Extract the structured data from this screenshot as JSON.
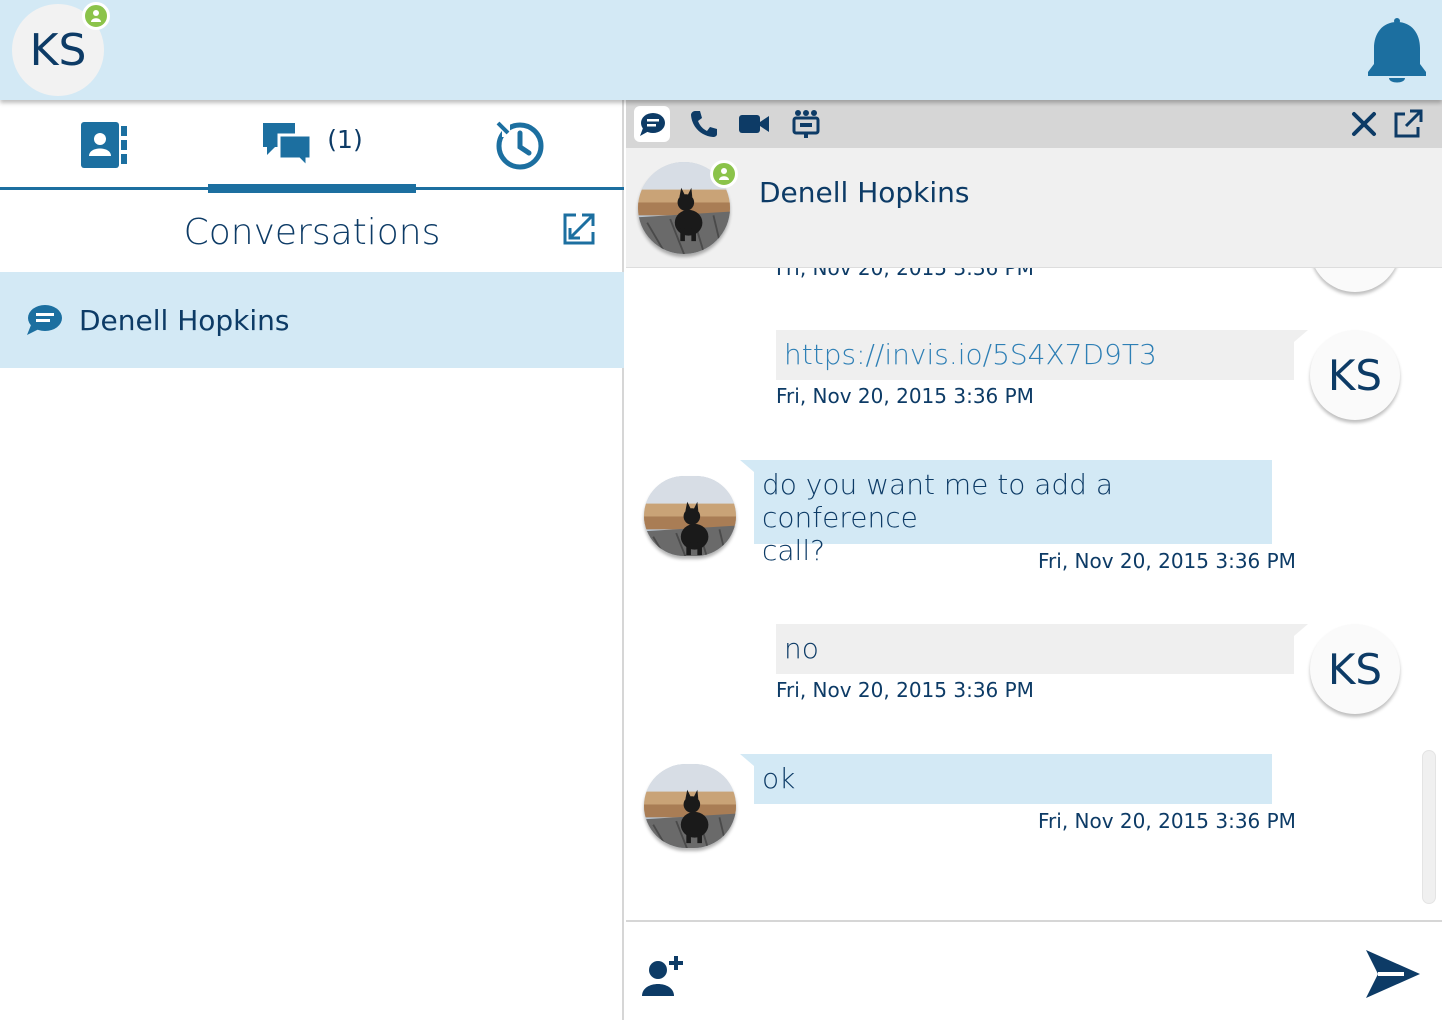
{
  "user": {
    "initials": "KS",
    "presence": "available"
  },
  "header": {
    "bell_icon": "bell-icon"
  },
  "left": {
    "tabs": [
      {
        "name": "contacts",
        "icon": "contacts-book-icon"
      },
      {
        "name": "conversations",
        "icon": "chat-bubbles-icon",
        "count": "(1)"
      },
      {
        "name": "history",
        "icon": "history-clock-icon"
      }
    ],
    "active_tab": "conversations",
    "title": "Conversations",
    "conversations": [
      {
        "name": "Denell Hopkins",
        "icon": "chat-icon"
      }
    ]
  },
  "chat": {
    "toolbar": [
      "chat-icon",
      "phone-icon",
      "video-icon",
      "conference-icon",
      "close-icon",
      "popout-icon"
    ],
    "contact": {
      "name": "Denell Hopkins",
      "presence": "available"
    },
    "partial_timestamp": "Fri, Nov 20, 2015 3:36 PM",
    "messages": [
      {
        "from": "me",
        "initials": "KS",
        "text": "https://invis.io/5S4X7D9T3",
        "time": "Fri, Nov 20, 2015 3:36 PM"
      },
      {
        "from": "them",
        "text_line1": "do you want me to add a conference",
        "text_line2": "call?",
        "time": "Fri, Nov 20, 2015 3:36 PM"
      },
      {
        "from": "me",
        "initials": "KS",
        "text": "no",
        "time": "Fri, Nov 20, 2015 3:36 PM"
      },
      {
        "from": "them",
        "text": "ok",
        "time": "Fri, Nov 20, 2015 3:36 PM"
      }
    ]
  },
  "colors": {
    "accent": "#1c6fa0",
    "navy": "#0d3b66",
    "presence": "#8bc34a",
    "highlight": "#d3e9f5"
  }
}
